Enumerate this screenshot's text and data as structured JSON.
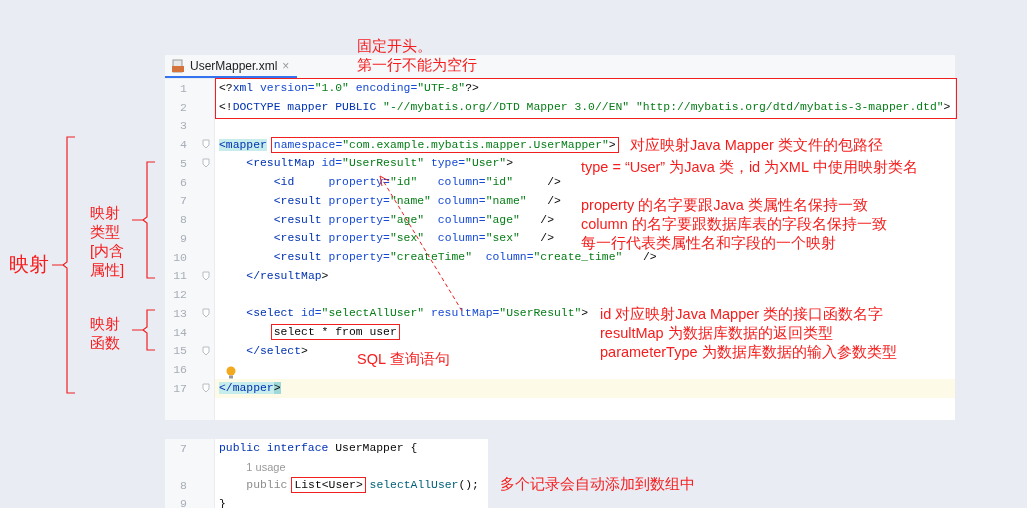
{
  "editor": {
    "tab": {
      "label": "UserMapper.xml",
      "close": "×",
      "selected": true
    },
    "lines": [
      {
        "number": "1",
        "current": false,
        "fold": false,
        "tokens": [
          {
            "kind": "punct",
            "text": "<?"
          },
          {
            "kind": "tag",
            "text": "xml"
          },
          {
            "kind": "attr",
            "text": " version="
          },
          {
            "kind": "value",
            "text": "\"1.0\""
          },
          {
            "kind": "attr",
            "text": " encoding="
          },
          {
            "kind": "value",
            "text": "\"UTF-8\""
          },
          {
            "kind": "punct",
            "text": "?>"
          }
        ]
      },
      {
        "number": "2",
        "current": false,
        "fold": false,
        "tokens": [
          {
            "kind": "punct",
            "text": "<!"
          },
          {
            "kind": "tag",
            "text": "DOCTYPE mapper PUBLIC"
          },
          {
            "kind": "value",
            "text": " \"-//mybatis.org//DTD Mapper 3.0//EN\" \"http://mybatis.org/dtd/mybatis-3-mapper.dtd\""
          },
          {
            "kind": "punct",
            "text": ">"
          }
        ]
      },
      {
        "number": "3",
        "current": false,
        "fold": false
      },
      {
        "number": "4",
        "current": false,
        "fold": true,
        "tokens": [
          {
            "kind": "tag-match",
            "text": "<mapper"
          },
          {
            "kind": "gap-box",
            "tokens": [
              {
                "kind": "attr",
                "text": "namespace="
              },
              {
                "kind": "value",
                "text": "\"com.example.mybatis.mapper.UserMapper\""
              },
              {
                "kind": "punct",
                "text": ">"
              }
            ]
          }
        ],
        "children": [
          {
            "number": "5",
            "current": false,
            "fold": true,
            "tokens": [
              {
                "kind": "tag",
                "text": "<resultMap"
              },
              {
                "kind": "attr",
                "text": " id="
              },
              {
                "kind": "value",
                "text": "\"UserResult\""
              },
              {
                "kind": "attr",
                "text": " type="
              },
              {
                "kind": "value",
                "text": "\"User\""
              },
              {
                "kind": "punct",
                "text": ">"
              }
            ],
            "children": [
              {
                "number": "6",
                "current": false,
                "fold": false,
                "tokens": [
                  {
                    "kind": "tag",
                    "text": "<id"
                  },
                  {
                    "kind": "attr",
                    "text": "     property="
                  },
                  {
                    "kind": "value",
                    "text": "\"id\""
                  },
                  {
                    "kind": "attr",
                    "text": "   column="
                  },
                  {
                    "kind": "value",
                    "text": "\"id\""
                  },
                  {
                    "kind": "punct",
                    "text": "     />"
                  }
                ]
              },
              {
                "number": "7",
                "current": false,
                "fold": false,
                "tokens": [
                  {
                    "kind": "tag",
                    "text": "<result"
                  },
                  {
                    "kind": "attr",
                    "text": " property="
                  },
                  {
                    "kind": "value",
                    "text": "\"name\""
                  },
                  {
                    "kind": "attr",
                    "text": " column="
                  },
                  {
                    "kind": "value",
                    "text": "\"name\""
                  },
                  {
                    "kind": "punct",
                    "text": "   />"
                  }
                ]
              },
              {
                "number": "8",
                "current": false,
                "fold": false,
                "tokens": [
                  {
                    "kind": "tag",
                    "text": "<result"
                  },
                  {
                    "kind": "attr",
                    "text": " property="
                  },
                  {
                    "kind": "value",
                    "text": "\"age\""
                  },
                  {
                    "kind": "attr",
                    "text": "  column="
                  },
                  {
                    "kind": "value",
                    "text": "\"age\""
                  },
                  {
                    "kind": "punct",
                    "text": "   />"
                  }
                ]
              },
              {
                "number": "9",
                "current": false,
                "fold": false,
                "tokens": [
                  {
                    "kind": "tag",
                    "text": "<result"
                  },
                  {
                    "kind": "attr",
                    "text": " property="
                  },
                  {
                    "kind": "value",
                    "text": "\"sex\""
                  },
                  {
                    "kind": "attr",
                    "text": "  column="
                  },
                  {
                    "kind": "value",
                    "text": "\"sex\""
                  },
                  {
                    "kind": "punct",
                    "text": "   />"
                  }
                ]
              },
              {
                "number": "10",
                "current": false,
                "fold": false,
                "tokens": [
                  {
                    "kind": "tag",
                    "text": "<result"
                  },
                  {
                    "kind": "attr",
                    "text": " property="
                  },
                  {
                    "kind": "value",
                    "text": "\"createTime\""
                  },
                  {
                    "kind": "attr",
                    "text": "  column="
                  },
                  {
                    "kind": "value",
                    "text": "\"create_time\""
                  },
                  {
                    "kind": "punct",
                    "text": "   />"
                  }
                ]
              }
            ]
          },
          {
            "number": "11",
            "current": false,
            "fold": true,
            "tokens": [
              {
                "kind": "tag",
                "text": "</resultMap"
              },
              {
                "kind": "punct",
                "text": ">"
              }
            ]
          },
          {
            "number": "12",
            "current": false,
            "fold": false
          },
          {
            "number": "13",
            "current": false,
            "fold": true,
            "tokens": [
              {
                "kind": "tag",
                "text": "<select"
              },
              {
                "kind": "attr",
                "text": " id="
              },
              {
                "kind": "value",
                "text": "\"selectAllUser\""
              },
              {
                "kind": "attr",
                "text": " resultMap="
              },
              {
                "kind": "value",
                "text": "\"UserResult\""
              },
              {
                "kind": "punct",
                "text": ">"
              }
            ],
            "children": [
              {
                "number": "14",
                "current": false,
                "fold": false,
                "tokens": [
                  {
                    "kind": "box",
                    "tokens": [
                      {
                        "kind": "plain",
                        "text": "select * from user"
                      }
                    ]
                  }
                ]
              }
            ]
          },
          {
            "number": "15",
            "current": false,
            "fold": true,
            "tokens": [
              {
                "kind": "tag",
                "text": "</select"
              },
              {
                "kind": "punct",
                "text": ">"
              }
            ]
          },
          {
            "number": "16",
            "current": false,
            "fold": false
          }
        ]
      },
      {
        "number": "17",
        "current": true,
        "fold": true,
        "tokens": [
          {
            "kind": "tag-match",
            "text": "</mapper"
          },
          {
            "kind": "punct-match",
            "text": ">"
          }
        ]
      }
    ]
  },
  "snippet": {
    "lines": [
      {
        "kind": "code",
        "number": "7",
        "tokens": [
          {
            "kind": "keyword",
            "text": "public"
          },
          {
            "kind": "keyword",
            "text": " interface"
          },
          {
            "kind": "plain",
            "text": " UserMapper {"
          }
        ],
        "children": [
          {
            "kind": "hint",
            "text": "1 usage"
          },
          {
            "kind": "code",
            "number": "8",
            "tokens": [
              {
                "kind": "muted",
                "text": "public"
              },
              {
                "kind": "gap-box",
                "tokens": [
                  {
                    "kind": "plain",
                    "text": "List<User>"
                  }
                ]
              },
              {
                "kind": "method",
                "text": " selectAllUser"
              },
              {
                "kind": "plain",
                "text": "();"
              }
            ]
          }
        ]
      },
      {
        "kind": "code",
        "number": "9",
        "tokens": [
          {
            "kind": "plain",
            "text": "}"
          }
        ]
      }
    ]
  },
  "annotations": [
    {
      "lines": [
        "固定开头。",
        "第一行不能为空行"
      ]
    },
    {
      "lines": [
        "对应映射Java Mapper 类文件的包路径"
      ]
    },
    {
      "lines": [
        "type = “User” 为Java 类，id 为XML 中使用映射类名"
      ]
    },
    {
      "lines": [
        "property 的名字要跟Java 类属性名保持一致",
        "column 的名字要跟数据库表的字段名保持一致",
        "每一行代表类属性名和字段的一个映射"
      ]
    },
    {
      "lines": [
        "id 对应映射Java Mapper 类的接口函数名字",
        "resultMap 为数据库数据的返回类型",
        "parameterType 为数据库数据的输入参数类型"
      ]
    },
    {
      "lines": [
        "SQL 查询语句"
      ]
    },
    {
      "lines": [
        "多个记录会自动添加到数组中"
      ]
    }
  ],
  "brace_labels": [
    {
      "lines": [
        "映射"
      ]
    },
    {
      "lines": [
        "映射",
        "类型",
        "[内含",
        "属性]"
      ]
    },
    {
      "lines": [
        "映射",
        "函数"
      ]
    }
  ]
}
